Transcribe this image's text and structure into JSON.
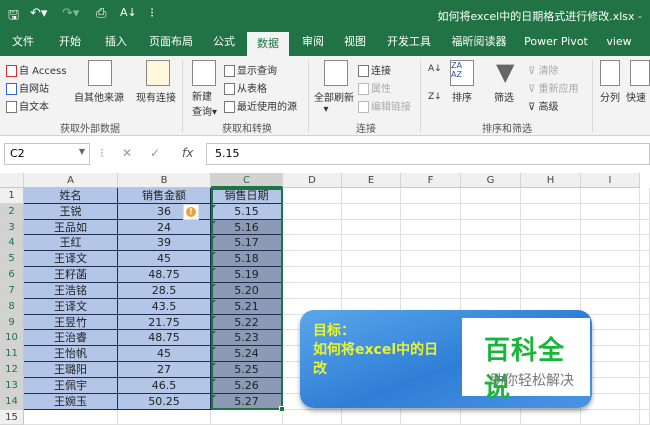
{
  "titlebar": {
    "title": "如何将excel中的日期格式进行修改.xlsx  -",
    "qat": [
      "save-icon",
      "undo-icon",
      "redo-icon",
      "print-preview-icon",
      "sort-icon",
      "customize-icon"
    ]
  },
  "tabs": [
    "文件",
    "开始",
    "插入",
    "页面布局",
    "公式",
    "数据",
    "审阅",
    "视图",
    "开发工具",
    "福昕阅读器",
    "Power Pivot",
    "view"
  ],
  "active_tab": "数据",
  "ribbon": {
    "get_external": {
      "access": "自 Access",
      "web": "自网站",
      "text": "自文本",
      "other": "自其他来源",
      "existing": "现有连接",
      "group": "获取外部数据"
    },
    "transform": {
      "new_query": "新建",
      "new_query2": "查询",
      "show_queries": "显示查询",
      "from_table": "从表格",
      "recent": "最近使用的源",
      "group": "获取和转换"
    },
    "connections": {
      "refresh_all": "全部刷新",
      "connections": "连接",
      "properties": "属性",
      "edit_links": "编辑链接",
      "group": "连接"
    },
    "sort_filter": {
      "sort": "排序",
      "filter": "筛选",
      "clear": "清除",
      "reapply": "重新应用",
      "advanced": "高级",
      "group": "排序和筛选"
    },
    "tools": {
      "split": "分列",
      "flash": "快速"
    }
  },
  "formula_bar": {
    "name_box": "C2",
    "cancel": "✕",
    "enter": "✓",
    "fx": "fx",
    "value": "5.15"
  },
  "columns": [
    "A",
    "B",
    "C",
    "D",
    "E",
    "F",
    "G",
    "H",
    "I"
  ],
  "rows": [
    "1",
    "2",
    "3",
    "4",
    "5",
    "6",
    "7",
    "8",
    "9",
    "10",
    "11",
    "12",
    "13",
    "14",
    "15"
  ],
  "table": {
    "headers": [
      "姓名",
      "销售金额",
      "销售日期"
    ],
    "data": [
      [
        "王锐",
        "36",
        "5.15"
      ],
      [
        "王品如",
        "24",
        "5.16"
      ],
      [
        "王红",
        "39",
        "5.17"
      ],
      [
        "王译文",
        "45",
        "5.18"
      ],
      [
        "王籽菡",
        "48.75",
        "5.19"
      ],
      [
        "王浩铭",
        "28.5",
        "5.20"
      ],
      [
        "王译文",
        "43.5",
        "5.21"
      ],
      [
        "王昱竹",
        "21.75",
        "5.22"
      ],
      [
        "王治睿",
        "48.75",
        "5.23"
      ],
      [
        "王怡帆",
        "45",
        "5.24"
      ],
      [
        "王璐阳",
        "27",
        "5.25"
      ],
      [
        "王佩宇",
        "46.5",
        "5.26"
      ],
      [
        "王婉玉",
        "50.25",
        "5.27"
      ]
    ]
  },
  "banner": {
    "line1": "目标：",
    "line2": "如何将excel中的日",
    "line3": "改"
  },
  "watermark": {
    "title": "百科全说",
    "subtitle": "助你轻松解决"
  }
}
